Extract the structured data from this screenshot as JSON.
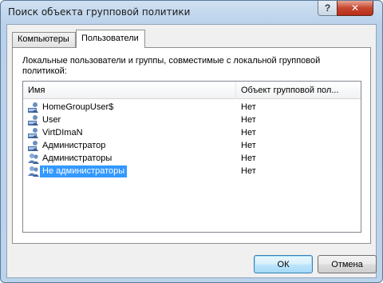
{
  "window": {
    "title": "Поиск объекта групповой политики"
  },
  "titlebar_buttons": {
    "help": "?",
    "close": "✕"
  },
  "tabs": [
    {
      "label": "Компьютеры",
      "active": false
    },
    {
      "label": "Пользователи",
      "active": true
    }
  ],
  "description": "Локальные пользователи и группы, совместимые с локальной групповой политикой:",
  "columns": {
    "name": "Имя",
    "gpo": "Объект групповой пол..."
  },
  "rows": [
    {
      "name": "HomeGroupUser$",
      "gpo": "Нет",
      "icon": "user-icon",
      "selected": false
    },
    {
      "name": "User",
      "gpo": "Нет",
      "icon": "user-icon",
      "selected": false
    },
    {
      "name": "VirtDImaN",
      "gpo": "Нет",
      "icon": "user-icon",
      "selected": false
    },
    {
      "name": "Администратор",
      "gpo": "Нет",
      "icon": "user-icon",
      "selected": false
    },
    {
      "name": "Администраторы",
      "gpo": "Нет",
      "icon": "group-icon",
      "selected": false
    },
    {
      "name": "Не администраторы",
      "gpo": "Нет",
      "icon": "group-icon",
      "selected": true
    }
  ],
  "buttons": {
    "ok": "ОК",
    "cancel": "Отмена"
  },
  "colors": {
    "selection": "#3399ff",
    "titlebar": "#b9d1ea",
    "close_button": "#c7472f"
  }
}
